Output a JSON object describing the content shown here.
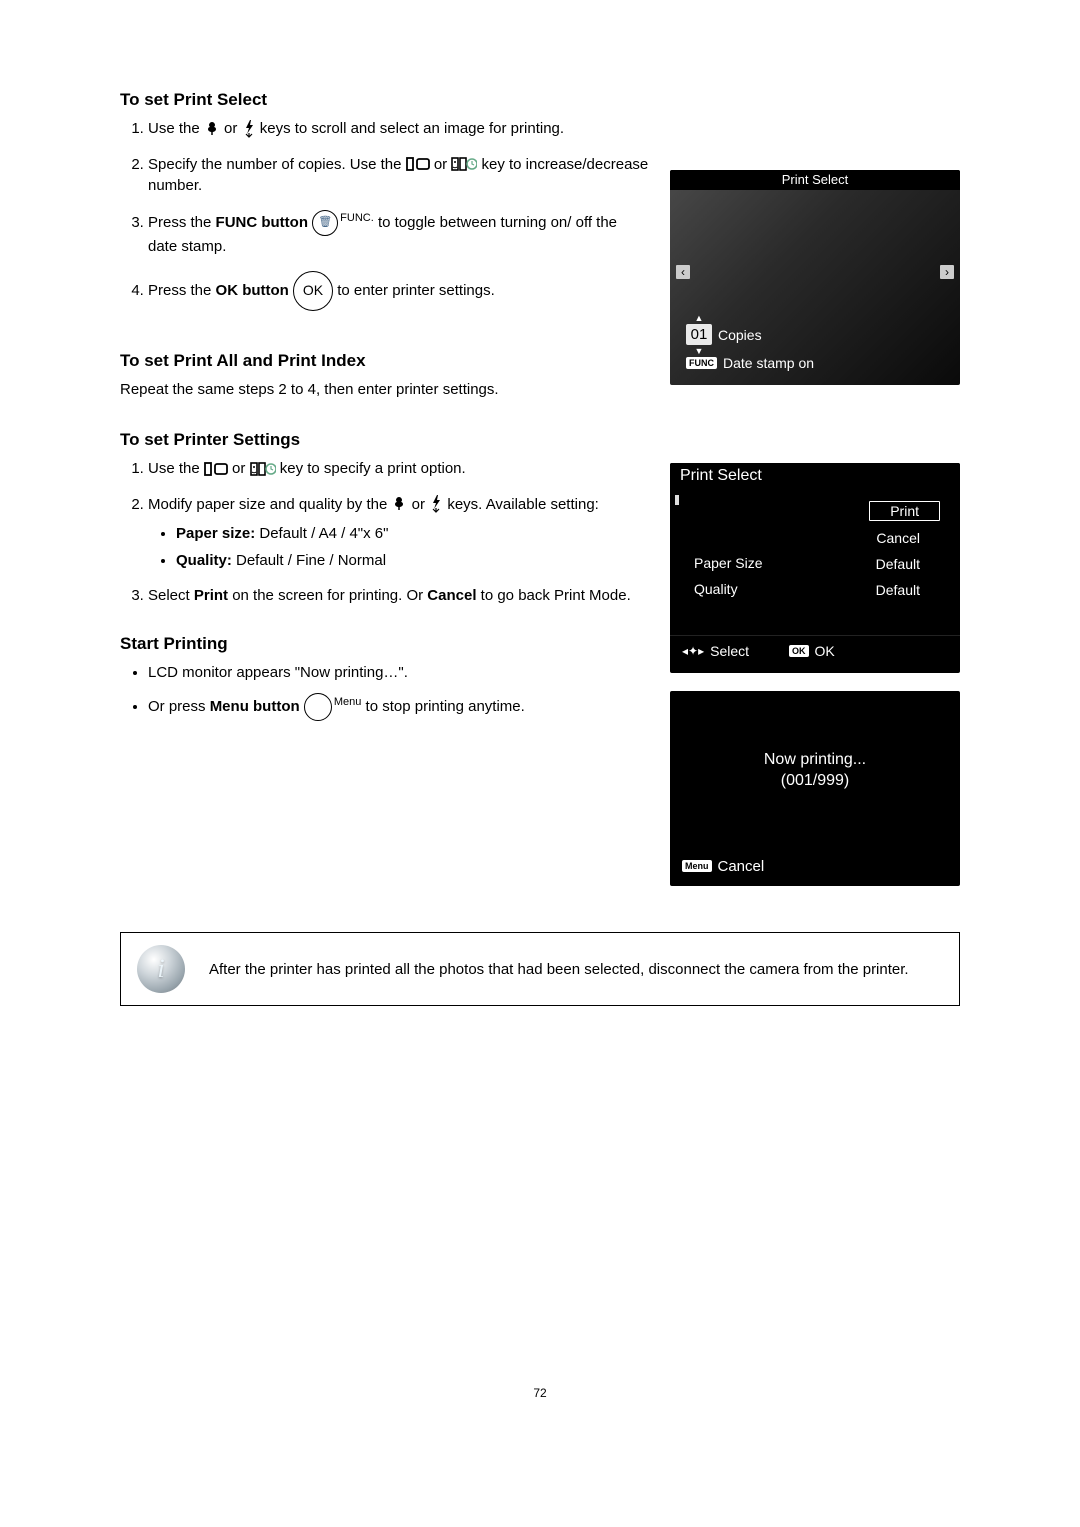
{
  "sections": {
    "s1": {
      "heading": "To set Print Select",
      "step1a": "Use the ",
      "step1b": " or ",
      "step1c": " keys to scroll and select an image for printing.",
      "step2a": "Specify the number of copies. Use the ",
      "step2b": " or ",
      "step2c": " key to increase/decrease number.",
      "step3a": "Press the ",
      "step3bold": "FUNC button",
      "step3b": " to toggle between turning on/ off the date stamp.",
      "step4a": "Press the ",
      "step4bold": "OK button",
      "step4b": " to enter printer settings."
    },
    "s2": {
      "heading": "To set Print All and Print Index",
      "text": "Repeat the same steps 2 to 4, then enter printer settings."
    },
    "s3": {
      "heading": "To set Printer Settings",
      "step1a": "Use the ",
      "step1b": " or ",
      "step1c": " key to specify a print option.",
      "step2a": "Modify paper size and quality by the ",
      "step2b": " or ",
      "step2c": " keys. Available setting:",
      "bullet1bold": "Paper size:",
      "bullet1": " Default / A4 / 4\"x 6\"",
      "bullet2bold": "Quality:",
      "bullet2": " Default / Fine / Normal",
      "step3a": "Select ",
      "step3bold1": "Print",
      "step3mid": " on the screen for printing. Or ",
      "step3bold2": "Cancel",
      "step3end": " to go back Print Mode."
    },
    "s4": {
      "heading": "Start Printing",
      "bullet1": "LCD monitor appears \"Now printing…\".",
      "bullet2a": "Or press ",
      "bullet2bold": "Menu button",
      "bullet2b": " to stop printing anytime."
    }
  },
  "icons": {
    "func_inner": "🗑",
    "func_label": "FUNC.",
    "ok_label": "OK",
    "menu_label": "Menu"
  },
  "lcd1": {
    "title": "Print Select",
    "copies_value": "01",
    "copies_label": "Copies",
    "func_badge": "FUNC",
    "date_stamp": "Date stamp on"
  },
  "lcd2": {
    "title": "Print Select",
    "rows": [
      {
        "label": "",
        "value": "Print",
        "sel": true
      },
      {
        "label": "",
        "value": "Cancel",
        "sel": false
      },
      {
        "label": "Paper Size",
        "value": "Default",
        "sel": false
      },
      {
        "label": "Quality",
        "value": "Default",
        "sel": false
      }
    ],
    "select_label": "Select",
    "ok_badge": "OK",
    "ok_label": "OK"
  },
  "lcd3": {
    "now_printing": "Now printing...",
    "progress": "(001/999)",
    "menu_badge": "Menu",
    "cancel": "Cancel"
  },
  "note": "After the printer has printed all the photos that had been selected, disconnect the camera from the printer.",
  "page_number": "72"
}
